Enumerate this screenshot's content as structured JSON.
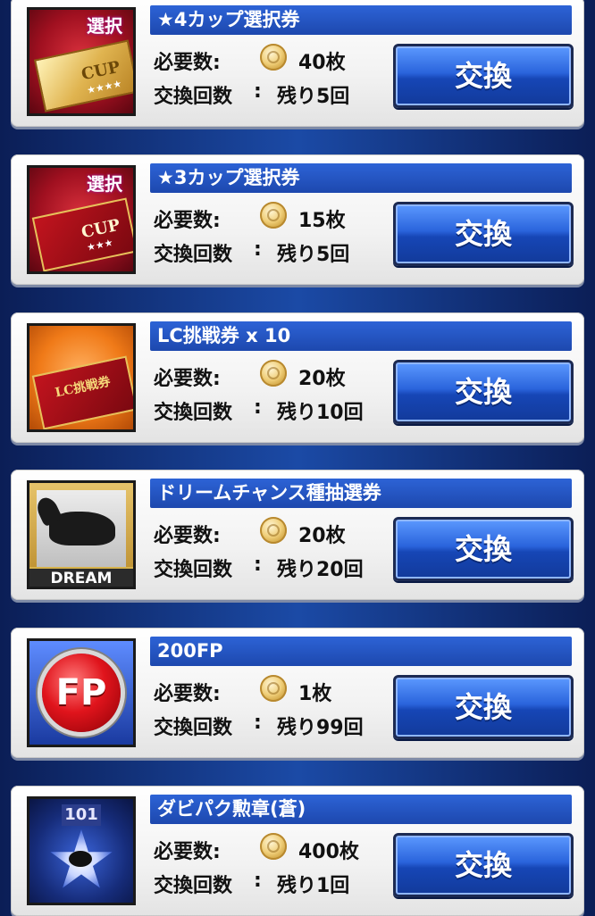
{
  "labels": {
    "required": "必要数:",
    "exchange_count": "交換回数",
    "colon": ":",
    "exchange_button": "交換"
  },
  "items": [
    {
      "title": "★4カップ選択券",
      "cost": "40枚",
      "remaining": "残り5回",
      "badge": "選択",
      "ticket_text": "CUP",
      "stars": "★★★★"
    },
    {
      "title": "★3カップ選択券",
      "cost": "15枚",
      "remaining": "残り5回",
      "badge": "選択",
      "ticket_text": "CUP",
      "stars": "★★★"
    },
    {
      "title": "LC挑戦券 x 10",
      "cost": "20枚",
      "remaining": "残り10回",
      "ticket_text": "LC挑戦券"
    },
    {
      "title": "ドリームチャンス種抽選券",
      "cost": "20枚",
      "remaining": "残り20回",
      "ticket_text": "DREAM"
    },
    {
      "title": "200FP",
      "cost": "1枚",
      "remaining": "残り99回",
      "ticket_text": "FP"
    },
    {
      "title": "ダビパク勲章(蒼)",
      "cost": "400枚",
      "remaining": "残り1回",
      "ticket_text": "101"
    }
  ],
  "colors": {
    "background": "#1b4aa6",
    "title_bar": "#2d63d6",
    "button": "#2a64dc"
  },
  "icons": [
    "coin-icon",
    "cup-ticket-icon",
    "lc-ticket-icon",
    "dream-ticket-icon",
    "fp-icon",
    "medal-icon"
  ]
}
